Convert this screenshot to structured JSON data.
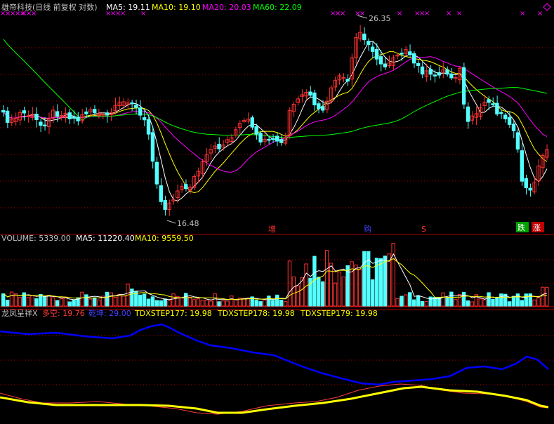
{
  "colors": {
    "bg": "#000000",
    "up": "#ff3232",
    "down": "#54ffff",
    "ma5": "#ffffff",
    "ma10": "#ffff00",
    "ma20": "#ff00ff",
    "ma60": "#00ff00",
    "grid": "#b00000",
    "duokong": "#ff3c3c",
    "qiankun": "#0000ff",
    "step": "#ffff00",
    "label": "#c0c0c0"
  },
  "main_panel": {
    "title": "雄帝科技(日线 前复权 对数)",
    "ma5": "MA5: 19.11",
    "ma10": "MA10: 19.10",
    "ma20": "MA20: 20.03",
    "ma60": "MA60: 22.09",
    "high_label": "26.35",
    "low_label": "16.48",
    "signals": [
      "增",
      "购",
      "S",
      "跌",
      "涨"
    ],
    "star_marks": "×"
  },
  "volume_panel": {
    "volume": "VOLUME: 5339.00",
    "ma5": "MA5: 11220.40",
    "ma10": "MA10: 9559.50"
  },
  "indicator_panel": {
    "name": "龙凤呈祥X",
    "duokong": "多空: 19.76",
    "qiankun": "乾坤: 29.00",
    "step177": "TDXSTEP177: 19.98",
    "step178": "TDXSTEP178: 19.98",
    "step179": "TDXSTEP179: 19.98"
  },
  "chart_data": {
    "type": "candlestick",
    "price_range": [
      16.0,
      27.2
    ],
    "candle_count": 132,
    "series": [
      {
        "name": "MA5",
        "values": [
          19.11
        ]
      },
      {
        "name": "MA10",
        "values": [
          19.1
        ]
      },
      {
        "name": "MA20",
        "values": [
          20.03
        ]
      },
      {
        "name": "MA60",
        "values": [
          22.09
        ]
      },
      {
        "name": "VOLUME",
        "values": [
          5339.0
        ]
      },
      {
        "name": "多空",
        "values": [
          19.76
        ]
      },
      {
        "name": "乾坤",
        "values": [
          29.0
        ]
      },
      {
        "name": "TDXSTEP177",
        "values": [
          19.98
        ]
      },
      {
        "name": "TDXSTEP178",
        "values": [
          19.98
        ]
      },
      {
        "name": "TDXSTEP179",
        "values": [
          19.98
        ]
      }
    ],
    "marked_high": 26.35,
    "marked_low": 16.48
  }
}
